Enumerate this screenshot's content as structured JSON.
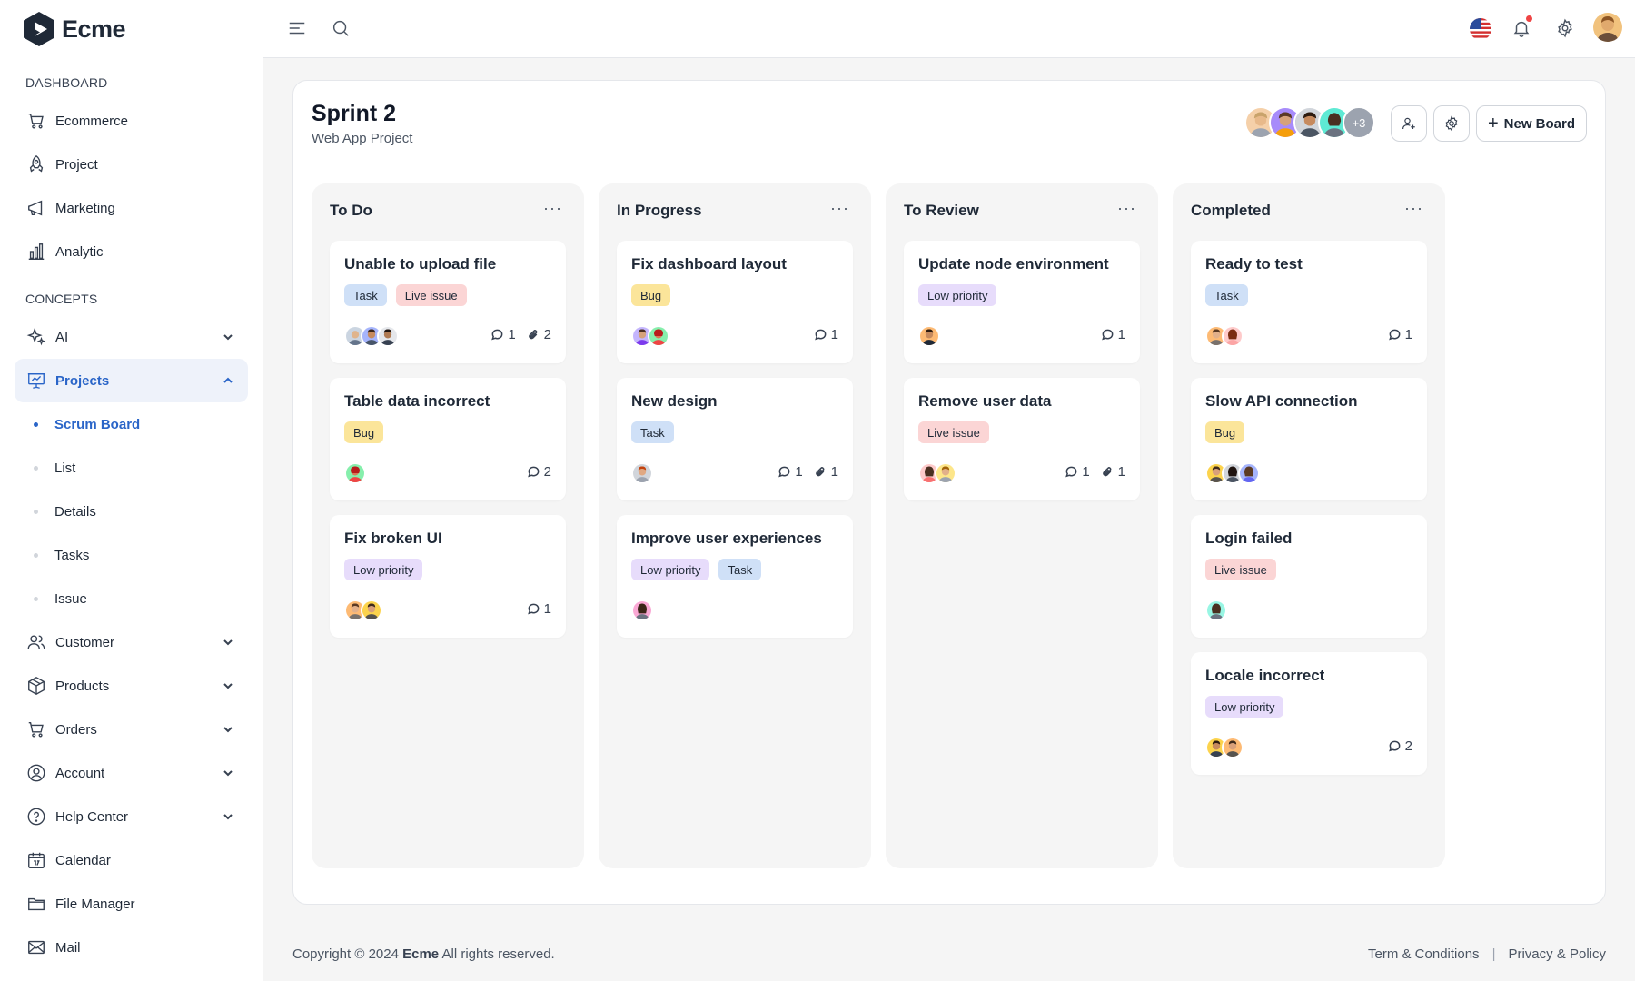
{
  "brand": {
    "name": "Ecme"
  },
  "sidebar": {
    "section_dashboard": "DASHBOARD",
    "section_concepts": "CONCEPTS",
    "dashboard_items": [
      {
        "label": "Ecommerce",
        "icon": "cart-icon"
      },
      {
        "label": "Project",
        "icon": "rocket-icon"
      },
      {
        "label": "Marketing",
        "icon": "megaphone-icon"
      },
      {
        "label": "Analytic",
        "icon": "bar-chart-icon"
      }
    ],
    "concept_items": [
      {
        "label": "AI",
        "icon": "sparkles-icon",
        "expandable": true
      },
      {
        "label": "Projects",
        "icon": "presentation-icon",
        "expandable": true,
        "expanded": true,
        "active": true
      },
      {
        "label": "Customer",
        "icon": "users-icon",
        "expandable": true
      },
      {
        "label": "Products",
        "icon": "box-icon",
        "expandable": true
      },
      {
        "label": "Orders",
        "icon": "cart-icon",
        "expandable": true
      },
      {
        "label": "Account",
        "icon": "user-circle-icon",
        "expandable": true
      },
      {
        "label": "Help Center",
        "icon": "help-icon",
        "expandable": true
      },
      {
        "label": "Calendar",
        "icon": "calendar-icon"
      },
      {
        "label": "File Manager",
        "icon": "folder-icon"
      },
      {
        "label": "Mail",
        "icon": "mail-icon"
      }
    ],
    "projects_sub": [
      {
        "label": "Scrum Board",
        "active": true
      },
      {
        "label": "List"
      },
      {
        "label": "Details"
      },
      {
        "label": "Tasks"
      },
      {
        "label": "Issue"
      }
    ]
  },
  "header": {
    "icons": [
      "menu-icon",
      "search-icon",
      "us-flag-icon",
      "bell-icon",
      "gear-icon",
      "avatar"
    ]
  },
  "board": {
    "title": "Sprint 2",
    "subtitle": "Web App Project",
    "members_more": "+3",
    "new_board_label": "New Board",
    "columns": [
      {
        "title": "To Do",
        "cards": [
          {
            "title": "Unable to upload file",
            "tags": [
              "Task",
              "Live issue"
            ],
            "avatars": 3,
            "comments": "1",
            "attachments": "2"
          },
          {
            "title": "Table data incorrect",
            "tags": [
              "Bug"
            ],
            "avatars": 1,
            "comments": "2"
          },
          {
            "title": "Fix broken UI",
            "tags": [
              "Low priority"
            ],
            "avatars": 2,
            "comments": "1"
          }
        ]
      },
      {
        "title": "In Progress",
        "cards": [
          {
            "title": "Fix dashboard layout",
            "tags": [
              "Bug"
            ],
            "avatars": 2,
            "comments": "1"
          },
          {
            "title": "New design",
            "tags": [
              "Task"
            ],
            "avatars": 1,
            "comments": "1",
            "attachments": "1"
          },
          {
            "title": "Improve user experiences",
            "tags": [
              "Low priority",
              "Task"
            ],
            "avatars": 1
          }
        ]
      },
      {
        "title": "To Review",
        "cards": [
          {
            "title": "Update node environment",
            "tags": [
              "Low priority"
            ],
            "avatars": 1,
            "comments": "1"
          },
          {
            "title": "Remove user data",
            "tags": [
              "Live issue"
            ],
            "avatars": 2,
            "comments": "1",
            "attachments": "1"
          }
        ]
      },
      {
        "title": "Completed",
        "cards": [
          {
            "title": "Ready to test",
            "tags": [
              "Task"
            ],
            "avatars": 2,
            "comments": "1"
          },
          {
            "title": "Slow API connection",
            "tags": [
              "Bug"
            ],
            "avatars": 3
          },
          {
            "title": "Login failed",
            "tags": [
              "Live issue"
            ],
            "avatars": 1
          },
          {
            "title": "Locale incorrect",
            "tags": [
              "Low priority"
            ],
            "avatars": 2,
            "comments": "2"
          }
        ]
      }
    ],
    "tag_colors": {
      "Task": "#cfe0f7",
      "Live issue": "#fbd5d5",
      "Bug": "#fbe59a",
      "Low priority": "#e7dcfb"
    }
  },
  "colors": {
    "accent": "#2a65c8",
    "active_bg": "#eef2fa"
  },
  "footer": {
    "copyright_prefix": "Copyright © 2024",
    "copyright_brand": "Ecme",
    "copyright_suffix": "All rights reserved.",
    "terms": "Term & Conditions",
    "separator": "|",
    "privacy": "Privacy & Policy"
  }
}
